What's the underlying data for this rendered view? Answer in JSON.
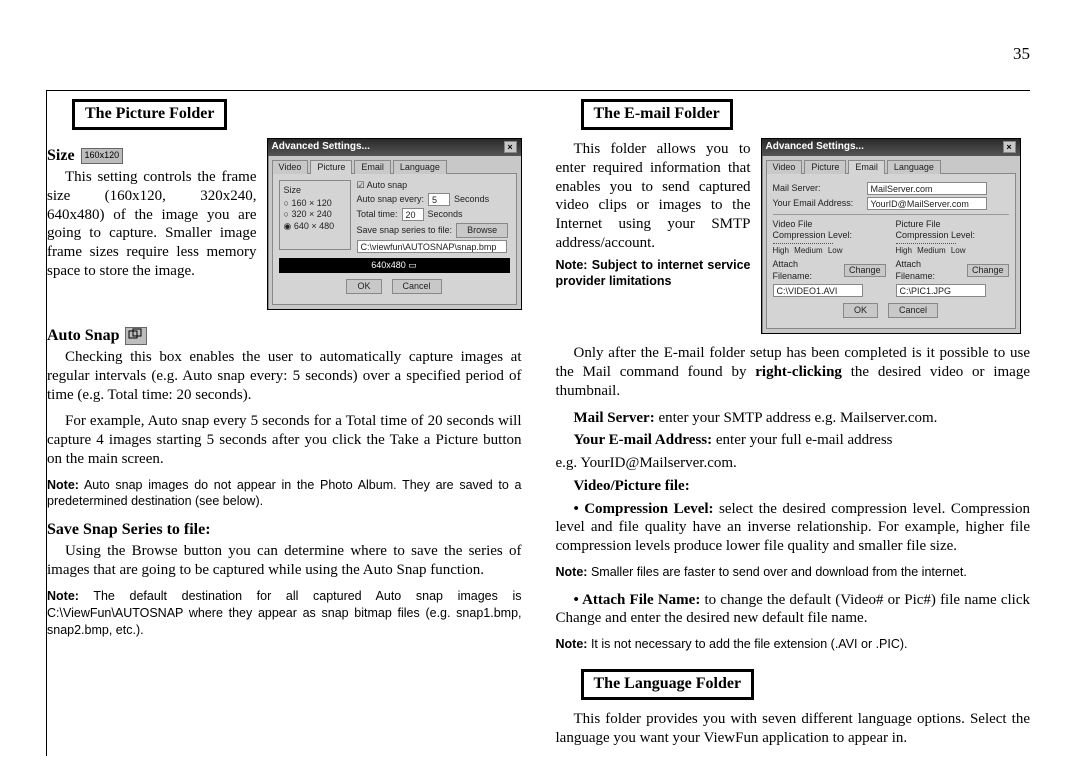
{
  "page_number": "35",
  "left": {
    "section_title": "The Picture Folder",
    "size_head": "Size",
    "size_icon": "160x120",
    "size_text": "This setting controls the frame size (160x120, 320x240, 640x480) of the image you are going to capture. Smaller image frame sizes require less memory space to store the image.",
    "auto_head": "Auto Snap",
    "auto_p1": "Checking this box enables the user to automatically capture images at regular intervals (e.g. Auto snap every: 5 seconds) over a specified period of time (e.g. Total time: 20 seconds).",
    "auto_p2": "For example, Auto snap every 5 seconds for a Total time of 20 seconds will capture 4 images starting 5 seconds after you click the Take a Picture button on the main screen.",
    "auto_note": "Note: Auto snap images do not appear in the Photo Album.  They are saved to a predetermined destination (see below).",
    "save_head": "Save Snap Series to file:",
    "save_p": "Using the Browse button you can determine where to save the series of images that are going to be captured while using the Auto Snap function.",
    "save_note": "Note: The default destination for all captured Auto snap images is C:\\ViewFun\\AUTOSNAP where they appear as snap bitmap files (e.g. snap1.bmp, snap2.bmp, etc.).",
    "dialog": {
      "title": "Advanced Settings...",
      "tabs": [
        "Video",
        "Picture",
        "Email",
        "Language"
      ],
      "active_tab": "Picture",
      "size_group": "Size",
      "opt1": "160 × 120",
      "opt2": "320 × 240",
      "opt3": "640 × 480",
      "check": "Auto snap",
      "every_lbl": "Auto snap every:",
      "every_val": "5",
      "every_unit": "Seconds",
      "total_lbl": "Total time:",
      "total_val": "20",
      "total_unit": "Seconds",
      "series_lbl": "Save snap series to file:",
      "browse": "Browse",
      "path": "C:\\viewfun\\AUTOSNAP\\snap.bmp",
      "bar": "640x480",
      "ok": "OK",
      "cancel": "Cancel"
    }
  },
  "right": {
    "section_title": "The E-mail Folder",
    "intro": "This folder allows you to enter required information that enables you to send captured video clips or images to the Internet using your SMTP address/account.",
    "intro_note": "Note: Subject to internet service provider limitations",
    "para1a": "Only after the E-mail folder setup has been completed is it possible to use the Mail command found by ",
    "para1b": "right-clicking",
    "para1c": " the desired video or image thumbnail.",
    "mail_label": "Mail Server:",
    "mail_text": " enter your SMTP address e.g. Mailserver.com.",
    "your_label": "Your E-mail Address:",
    "your_text": " enter your full e-mail address",
    "eg": "e.g. YourID@Mailserver.com.",
    "vp_label": "Video/Picture file:",
    "comp_label": "• Compression Level:",
    "comp_text": " select the desired compression level. Compression level and file quality have an inverse relationship. For example, higher file compression levels produce lower file quality and smaller file size.",
    "comp_note": "Note: Smaller files are faster to send over and download from the internet.",
    "attach_label": "• Attach File Name:",
    "attach_text": " to change the default (Video# or Pic#) file name click Change and enter the desired new default file name.",
    "attach_note": "Note: It is not necessary to add the file extension (.AVI or .PIC).",
    "lang_section": "The Language Folder",
    "lang_text": "This folder provides you with seven different language options. Select the language you want your ViewFun application to appear in.",
    "dialog": {
      "title": "Advanced Settings...",
      "tabs": [
        "Video",
        "Picture",
        "Email",
        "Language"
      ],
      "active_tab": "Email",
      "mailserver_lbl": "Mail Server:",
      "mailserver_val": "MailServer.com",
      "email_lbl": "Your Email Address:",
      "email_val": "YourID@MailServer.com",
      "vf_lbl": "Video File",
      "pf_lbl": "Picture File",
      "cl_lbl": "Compression Level:",
      "high": "High",
      "med": "Medium",
      "low": "Low",
      "af_lbl": "Attach Filename:",
      "change": "Change",
      "vfile": "C:\\VIDEO1.AVI",
      "pfile": "C:\\PIC1.JPG",
      "ok": "OK",
      "cancel": "Cancel"
    }
  }
}
